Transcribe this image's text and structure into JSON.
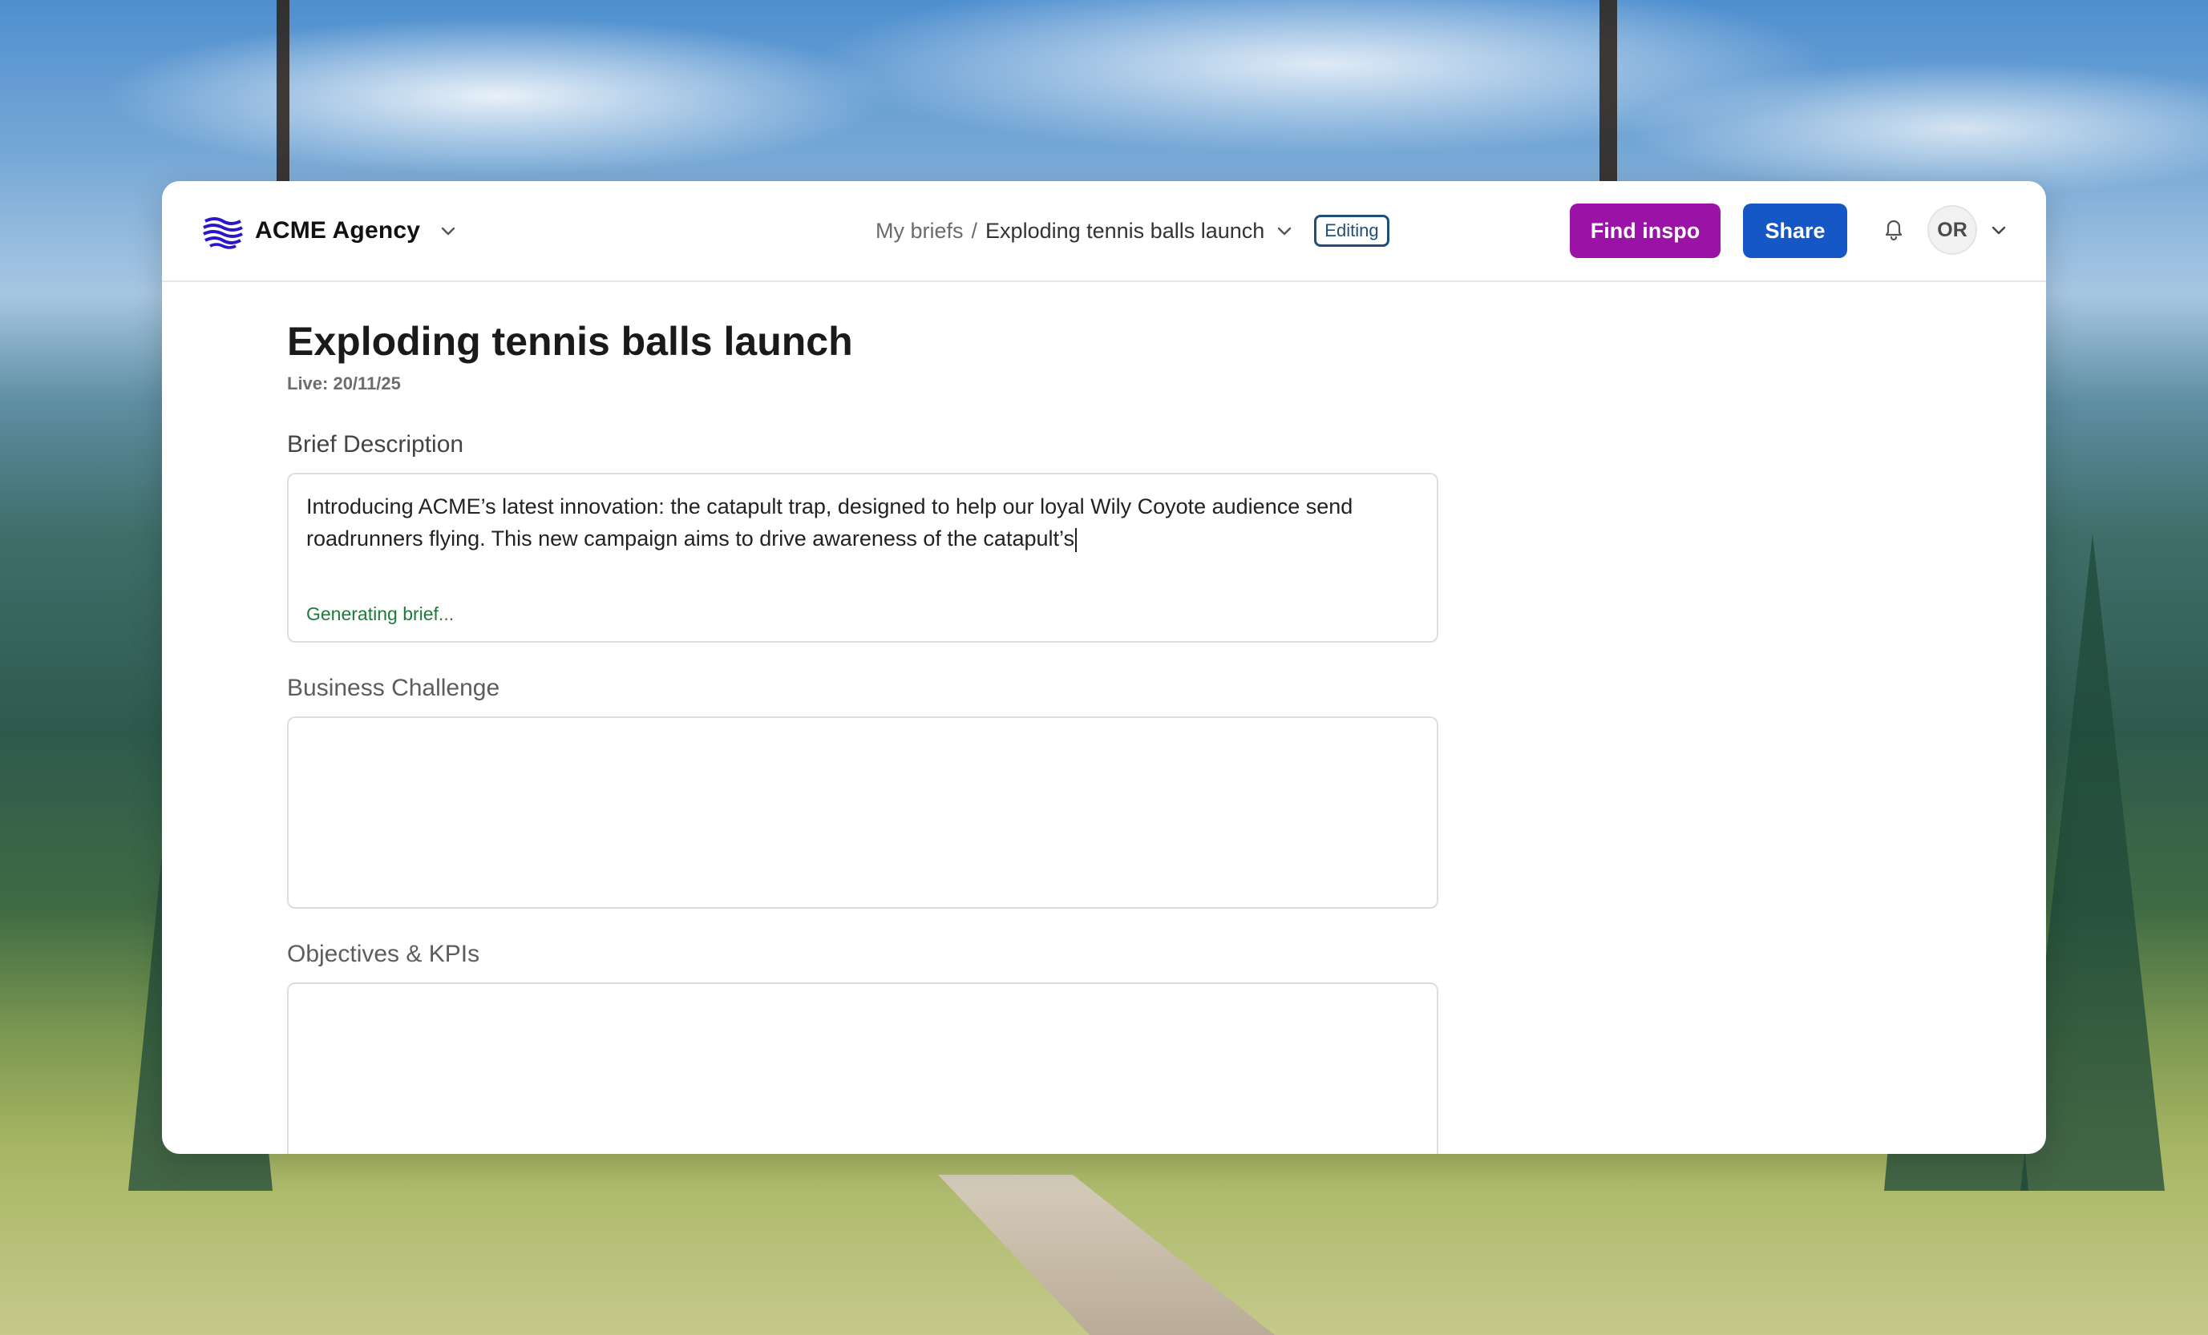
{
  "header": {
    "brand_name": "ACME Agency",
    "brand_logo": "wave-logo",
    "breadcrumb_parent": "My briefs",
    "breadcrumb_separator": "/",
    "breadcrumb_current": "Exploding tennis balls launch",
    "status_badge": "Editing",
    "find_inspo_label": "Find inspo",
    "share_label": "Share",
    "avatar_initials": "OR"
  },
  "brief": {
    "title": "Exploding tennis balls launch",
    "live_date": "Live: 20/11/25",
    "sections": [
      {
        "label": "Brief Description",
        "value": "Introducing ACME’s latest innovation: the catapult trap, designed to help our loyal Wily Coyote audience send roadrunners flying. This new campaign aims to drive awareness of the catapult’s",
        "status": "Generating brief..."
      },
      {
        "label": "Business Challenge",
        "value": ""
      },
      {
        "label": "Objectives & KPIs",
        "value": ""
      }
    ]
  },
  "colors": {
    "find_inspo_bg": "#9b12a6",
    "share_bg": "#1657c6",
    "badge_border": "#1f4f7a",
    "generating_text": "#1e7a3a"
  },
  "icons": {
    "brand_dropdown": "chevron-down-icon",
    "breadcrumb_dropdown": "chevron-down-icon",
    "notifications": "bell-icon",
    "account_dropdown": "chevron-down-icon"
  }
}
